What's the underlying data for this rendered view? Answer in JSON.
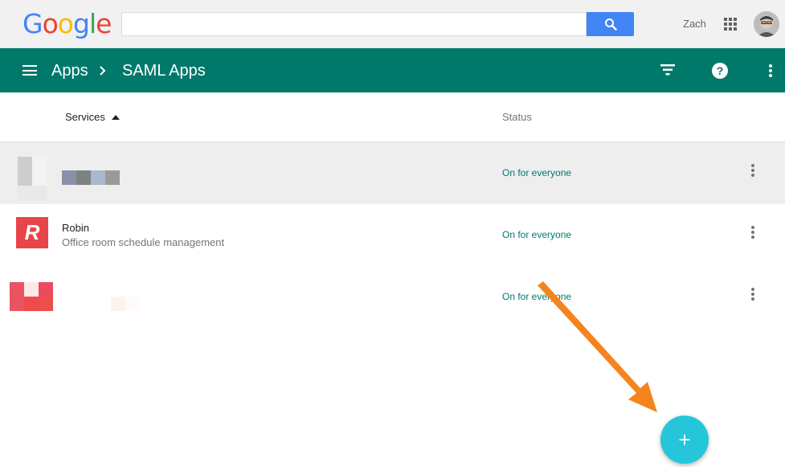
{
  "topbar": {
    "logo_letters": [
      {
        "char": "G",
        "color": "#4285f4"
      },
      {
        "char": "o",
        "color": "#ea4335"
      },
      {
        "char": "o",
        "color": "#fbbc05"
      },
      {
        "char": "g",
        "color": "#4285f4"
      },
      {
        "char": "l",
        "color": "#34a853"
      },
      {
        "char": "e",
        "color": "#ea4335"
      }
    ],
    "search_value": "",
    "search_icon": "search-icon",
    "username": "Zach",
    "apps_icon": "apps-grid-icon"
  },
  "header": {
    "menu_icon": "menu-icon",
    "breadcrumb": {
      "root": "Apps",
      "separator": ">",
      "current": "SAML Apps"
    },
    "filter_icon": "filter-icon",
    "help_label": "?",
    "more_icon": "more-vert-icon",
    "color": "#00796b"
  },
  "table": {
    "columns": {
      "services": "Services",
      "status": "Status"
    },
    "rows": [
      {
        "name": "",
        "description": "",
        "status": "On for everyone",
        "logo": "pixelated"
      },
      {
        "name": "Robin",
        "description": "Office room schedule management",
        "status": "On for everyone",
        "logo_letter": "R",
        "logo_color": "#e8454a"
      },
      {
        "name": "",
        "description": "",
        "status": "On for everyone",
        "logo": "pixelated"
      }
    ]
  },
  "fab": {
    "label": "+",
    "color": "#26c6da"
  },
  "annotation": {
    "arrow_color": "#f5841f"
  }
}
